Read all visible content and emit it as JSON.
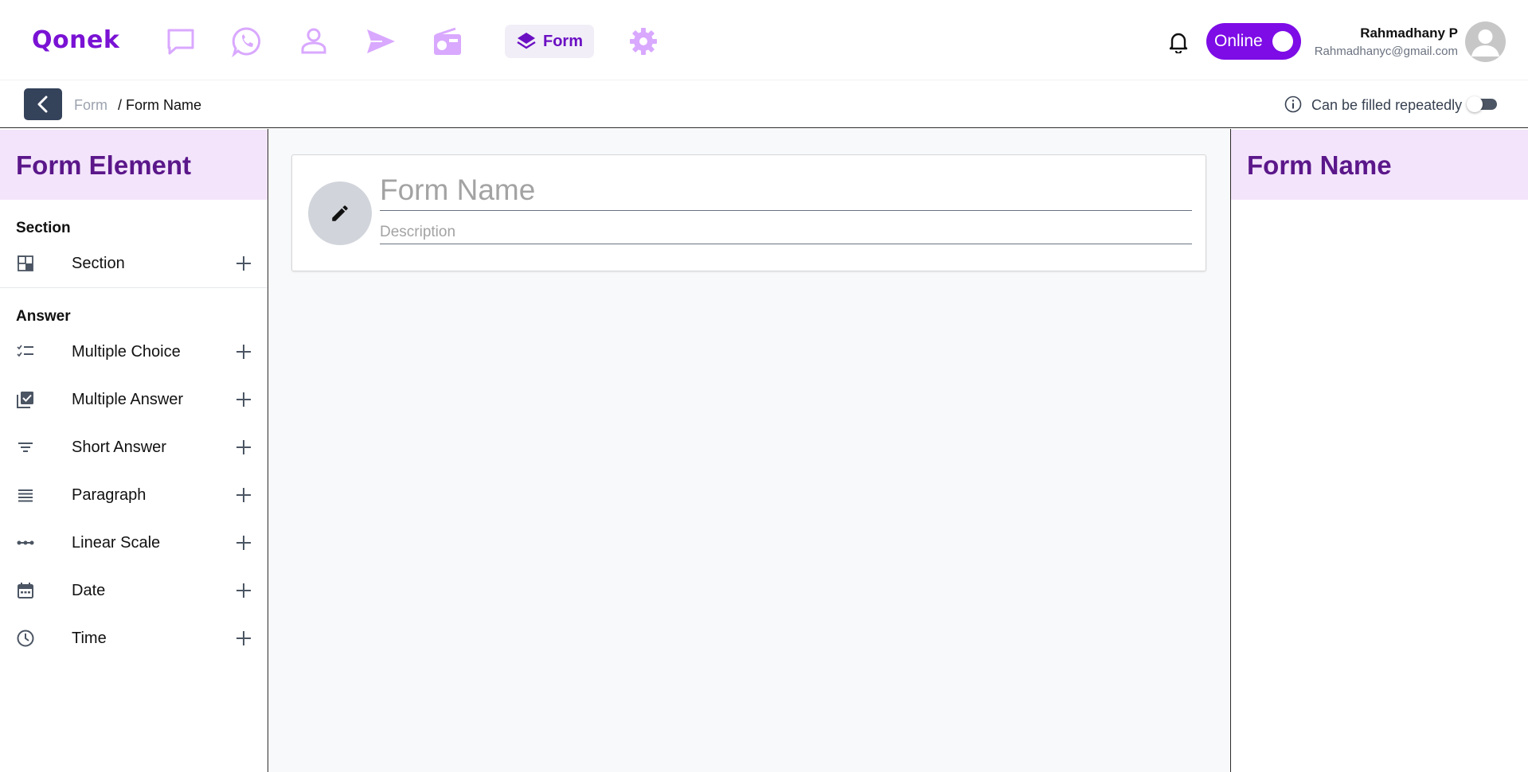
{
  "app": {
    "logo": "Qonek"
  },
  "nav": {
    "icons": [
      "chat-icon",
      "whatsapp-icon",
      "contact-icon",
      "send-icon",
      "radio-icon",
      "form-icon",
      "gear-icon"
    ],
    "active_label": "Form",
    "accent": "#7d0ce6",
    "inactive_color": "#d9a8ff"
  },
  "header": {
    "online_label": "Online",
    "user_name": "Rahmadhany P",
    "user_email": "Rahmadhanyc@gmail.com"
  },
  "subheader": {
    "breadcrumb_parent": "Form",
    "breadcrumb_current": "/ Form Name",
    "repeat_label": "Can be filled repeatedly",
    "repeat_enabled": false
  },
  "left_panel": {
    "title": "Form Element",
    "section_group": "Section",
    "section_items": [
      {
        "label": "Section",
        "icon": "section-icon"
      }
    ],
    "answer_group": "Answer",
    "answer_items": [
      {
        "label": "Multiple Choice",
        "icon": "checklist-icon"
      },
      {
        "label": "Multiple Answer",
        "icon": "checkbox-icon"
      },
      {
        "label": "Short Answer",
        "icon": "short-text-icon"
      },
      {
        "label": "Paragraph",
        "icon": "paragraph-icon"
      },
      {
        "label": "Linear Scale",
        "icon": "linear-scale-icon"
      },
      {
        "label": "Date",
        "icon": "calendar-icon"
      },
      {
        "label": "Time",
        "icon": "clock-icon"
      }
    ]
  },
  "form_card": {
    "title_placeholder": "Form Name",
    "title_value": "",
    "description_placeholder": "Description",
    "description_value": ""
  },
  "right_panel": {
    "title": "Form Name"
  }
}
